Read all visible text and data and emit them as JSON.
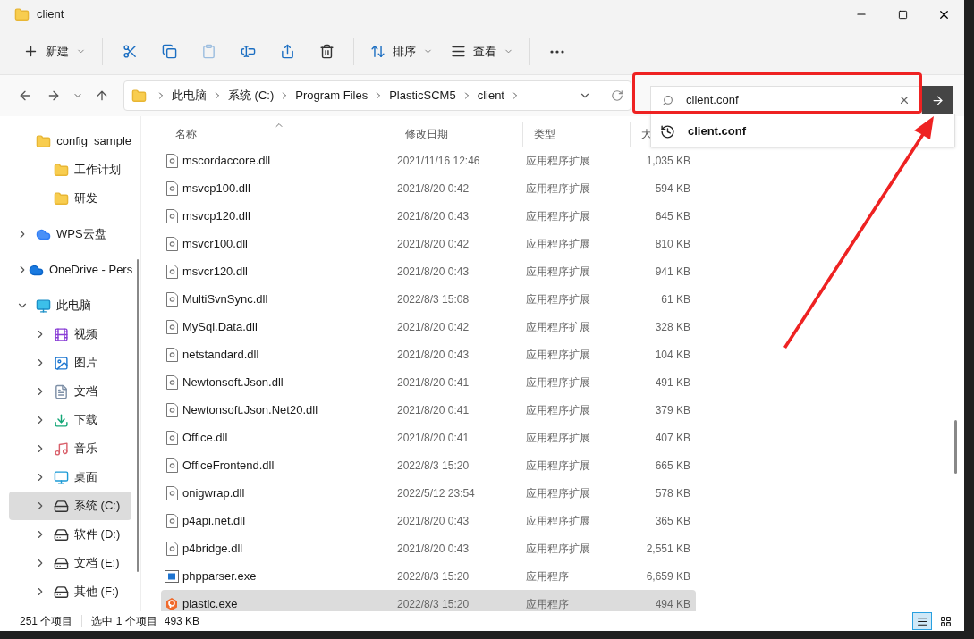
{
  "window": {
    "title": "client"
  },
  "toolbar": [
    {
      "kind": "new",
      "label": "新建",
      "disabled": false
    },
    {
      "kind": "cut",
      "disabled": false
    },
    {
      "kind": "copy",
      "disabled": false
    },
    {
      "kind": "paste",
      "disabled": true
    },
    {
      "kind": "rename",
      "disabled": false
    },
    {
      "kind": "share",
      "disabled": false
    },
    {
      "kind": "delete",
      "disabled": false
    },
    {
      "kind": "sort",
      "label": "排序",
      "disabled": false
    },
    {
      "kind": "view",
      "label": "查看",
      "disabled": false
    },
    {
      "kind": "more",
      "disabled": false
    }
  ],
  "breadcrumb": [
    "此电脑",
    "系统 (C:)",
    "Program Files",
    "PlasticSCM5",
    "client"
  ],
  "search": {
    "value": "client.conf",
    "suggestions": [
      "client.conf"
    ]
  },
  "sidebar": {
    "items": [
      {
        "kind": "folder",
        "label": "config_sample",
        "selected": false
      },
      {
        "kind": "folder",
        "label": "工作计划",
        "selected": false
      },
      {
        "kind": "folder",
        "label": "研发",
        "selected": false
      },
      {
        "kind": "wps",
        "label": "WPS云盘",
        "expanded": false,
        "selected": false
      },
      {
        "kind": "onedrive",
        "label": "OneDrive - Pers",
        "expanded": false,
        "selected": false
      },
      {
        "kind": "pc",
        "label": "此电脑",
        "expanded": true,
        "selected": false,
        "children": [
          {
            "kind": "video",
            "label": "视频",
            "expanded": false,
            "selected": false
          },
          {
            "kind": "picture",
            "label": "图片",
            "expanded": false,
            "selected": false
          },
          {
            "kind": "doc",
            "label": "文档",
            "expanded": false,
            "selected": false
          },
          {
            "kind": "download",
            "label": "下载",
            "expanded": false,
            "selected": false
          },
          {
            "kind": "music",
            "label": "音乐",
            "expanded": false,
            "selected": false
          },
          {
            "kind": "desktop",
            "label": "桌面",
            "expanded": false,
            "selected": false
          },
          {
            "kind": "system-drive",
            "label": "系统 (C:)",
            "expanded": false,
            "selected": true
          },
          {
            "kind": "drive",
            "label": "软件 (D:)",
            "expanded": false,
            "selected": false
          },
          {
            "kind": "drive",
            "label": "文档 (E:)",
            "expanded": false,
            "selected": false
          },
          {
            "kind": "drive",
            "label": "其他 (F:)",
            "expanded": false,
            "selected": false
          }
        ]
      }
    ]
  },
  "table": {
    "columns": [
      {
        "label": "名称",
        "sorted": true
      },
      {
        "label": "修改日期",
        "sorted": false
      },
      {
        "label": "类型",
        "sorted": false
      },
      {
        "label": "大",
        "sorted": false
      }
    ],
    "rows": [
      {
        "kind": "dll",
        "name": "mscordaccore.dll",
        "date": "2021/11/16 12:46",
        "type": "应用程序扩展",
        "size": "1,035 KB",
        "selected": false
      },
      {
        "kind": "dll",
        "name": "msvcp100.dll",
        "date": "2021/8/20 0:42",
        "type": "应用程序扩展",
        "size": "594 KB",
        "selected": false
      },
      {
        "kind": "dll",
        "name": "msvcp120.dll",
        "date": "2021/8/20 0:43",
        "type": "应用程序扩展",
        "size": "645 KB",
        "selected": false
      },
      {
        "kind": "dll",
        "name": "msvcr100.dll",
        "date": "2021/8/20 0:42",
        "type": "应用程序扩展",
        "size": "810 KB",
        "selected": false
      },
      {
        "kind": "dll",
        "name": "msvcr120.dll",
        "date": "2021/8/20 0:43",
        "type": "应用程序扩展",
        "size": "941 KB",
        "selected": false
      },
      {
        "kind": "dll",
        "name": "MultiSvnSync.dll",
        "date": "2022/8/3 15:08",
        "type": "应用程序扩展",
        "size": "61 KB",
        "selected": false
      },
      {
        "kind": "dll",
        "name": "MySql.Data.dll",
        "date": "2021/8/20 0:42",
        "type": "应用程序扩展",
        "size": "328 KB",
        "selected": false
      },
      {
        "kind": "dll",
        "name": "netstandard.dll",
        "date": "2021/8/20 0:43",
        "type": "应用程序扩展",
        "size": "104 KB",
        "selected": false
      },
      {
        "kind": "dll",
        "name": "Newtonsoft.Json.dll",
        "date": "2021/8/20 0:41",
        "type": "应用程序扩展",
        "size": "491 KB",
        "selected": false
      },
      {
        "kind": "dll",
        "name": "Newtonsoft.Json.Net20.dll",
        "date": "2021/8/20 0:41",
        "type": "应用程序扩展",
        "size": "379 KB",
        "selected": false
      },
      {
        "kind": "dll",
        "name": "Office.dll",
        "date": "2021/8/20 0:41",
        "type": "应用程序扩展",
        "size": "407 KB",
        "selected": false
      },
      {
        "kind": "dll",
        "name": "OfficeFrontend.dll",
        "date": "2022/8/3 15:20",
        "type": "应用程序扩展",
        "size": "665 KB",
        "selected": false
      },
      {
        "kind": "dll",
        "name": "onigwrap.dll",
        "date": "2022/5/12 23:54",
        "type": "应用程序扩展",
        "size": "578 KB",
        "selected": false
      },
      {
        "kind": "dll",
        "name": "p4api.net.dll",
        "date": "2021/8/20 0:43",
        "type": "应用程序扩展",
        "size": "365 KB",
        "selected": false
      },
      {
        "kind": "dll",
        "name": "p4bridge.dll",
        "date": "2021/8/20 0:43",
        "type": "应用程序扩展",
        "size": "2,551 KB",
        "selected": false
      },
      {
        "kind": "exe",
        "name": "phpparser.exe",
        "date": "2022/8/3 15:20",
        "type": "应用程序",
        "size": "6,659 KB",
        "selected": false
      },
      {
        "kind": "plastic",
        "name": "plastic.exe",
        "date": "2022/8/3 15:20",
        "type": "应用程序",
        "size": "494 KB",
        "selected": true
      }
    ]
  },
  "status_bar": {
    "count": "251 个项目",
    "selection": "选中 1 个项目",
    "size": "493 KB"
  },
  "view_buttons": [
    {
      "kind": "details",
      "selected": true
    },
    {
      "kind": "tiles",
      "selected": false
    }
  ]
}
